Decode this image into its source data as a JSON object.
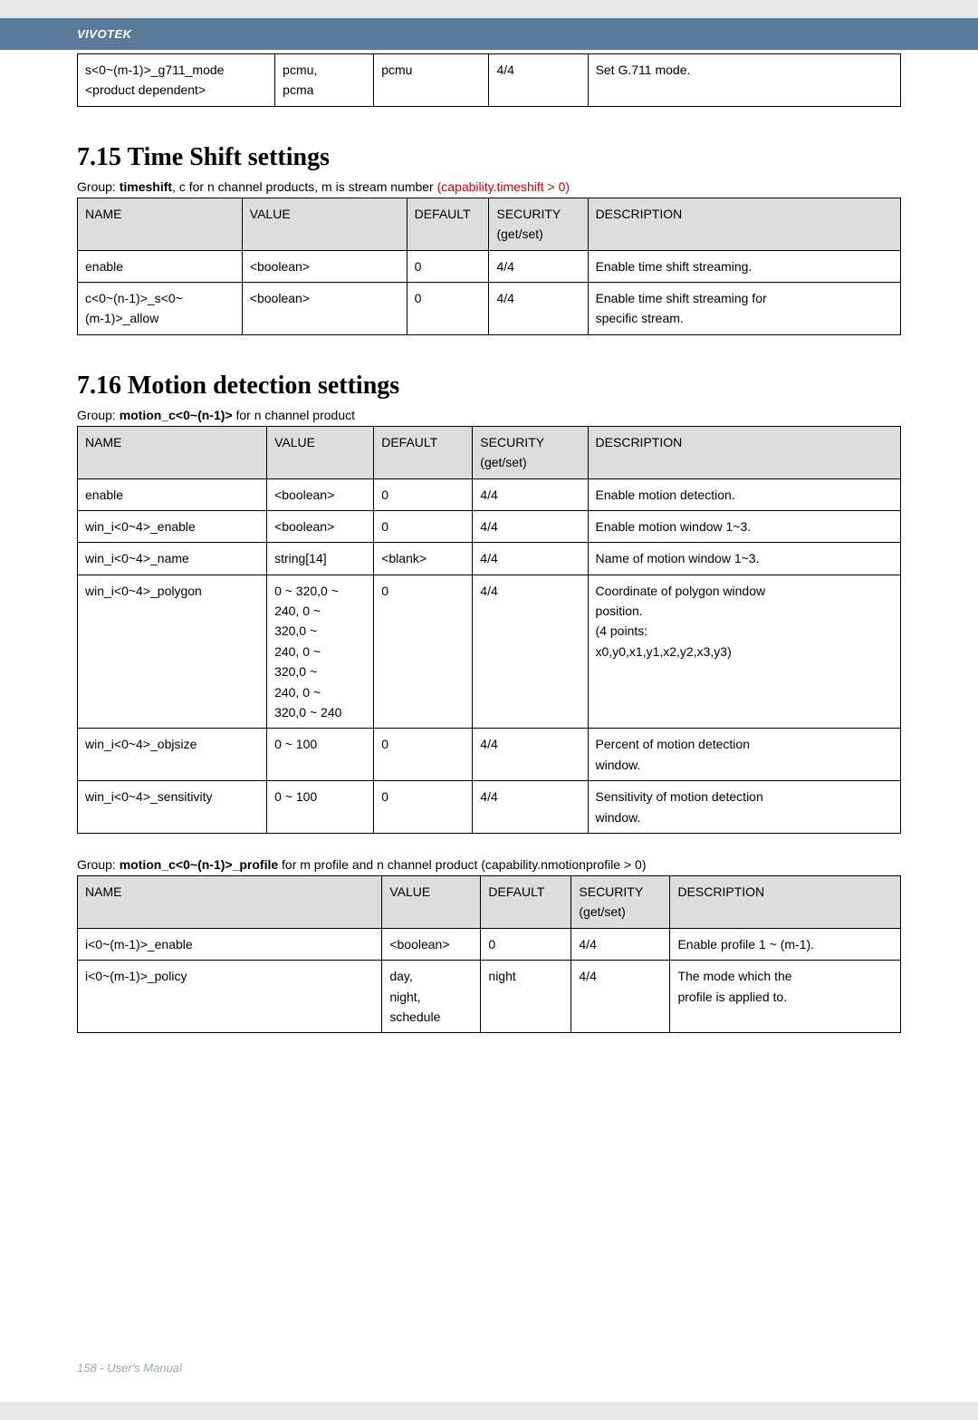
{
  "header": {
    "brand": "VIVOTEK"
  },
  "table1": {
    "r1c1": "s<0~(m-1)>_g711_mode",
    "r1c2": "pcmu,",
    "r1c3": "pcmu",
    "r1c4": "4/4",
    "r1c5": "Set G.711 mode.",
    "r2c1": "<product dependent>",
    "r2c2": "pcma"
  },
  "sec715": {
    "title": "7.15 Time Shift settings",
    "group_prefix": "Group: ",
    "group_bold": "timeshift",
    "group_rest": ", c for n channel products, m is stream number ",
    "group_red": "(capability.timeshift > 0)",
    "head": {
      "c1": "NAME",
      "c2": "VALUE",
      "c3": "DEFAULT",
      "c4": "SECURITY\n(get/set)",
      "c5": "DESCRIPTION"
    },
    "rows": [
      {
        "c1": "enable",
        "c2": "<boolean>",
        "c3": "0",
        "c4": "4/4",
        "c5": "Enable time shift streaming."
      },
      {
        "c1": "c<0~(n-1)>_s<0~(m-1)>_allow",
        "c2": "<boolean>",
        "c3": "0",
        "c4": "4/4",
        "c5a": "Enable time shift streaming for",
        "c5b": "specific stream."
      }
    ]
  },
  "sec716": {
    "title": "7.16 Motion detection settings",
    "group_prefix": "Group: ",
    "group_bold": "motion_c<0~(n-1)>",
    "group_rest": " for n channel product",
    "head": {
      "c1": "NAME",
      "c2": "VALUE",
      "c3": "DEFAULT",
      "c4": "SECURITY\n(get/set)",
      "c5": "DESCRIPTION"
    },
    "rows": [
      {
        "c1": "enable",
        "c2": "<boolean>",
        "c3": "0",
        "c4": "4/4",
        "c5": "Enable motion detection."
      },
      {
        "c1": "win_i<0~4>_enable",
        "c2": "<boolean>",
        "c3": "0",
        "c4": "4/4",
        "c5": "Enable motion window 1~3."
      },
      {
        "c1": "win_i<0~4>_name",
        "c2": "string[14]",
        "c3": "<blank>",
        "c4": "4/4",
        "c5": "Name of motion window 1~3."
      },
      {
        "c1": "win_i<0~4>_polygon",
        "c2": "0 ~ 320,0 ~ 240, 0 ~ 320,0 ~ 240, 0 ~ 320,0 ~ 240, 0 ~ 320,0 ~ 240",
        "c3": "0",
        "c4": "4/4",
        "c5": "Coordinate of polygon window position.\n(4 points: x0,y0,x1,y1,x2,y2,x3,y3)"
      },
      {
        "c1": "win_i<0~4>_objsize",
        "c2": "0 ~ 100",
        "c3": "0",
        "c4": "4/4",
        "c5": "Percent of motion detection window."
      },
      {
        "c1": "win_i<0~4>_sensitivity",
        "c2": "0 ~ 100",
        "c3": "0",
        "c4": "4/4",
        "c5": "Sensitivity of motion detection window."
      }
    ]
  },
  "profile": {
    "group_prefix": "Group: ",
    "group_bold": "motion_c<0~(n-1)>_profile",
    "group_rest": " for m profile and n channel product (capability.nmotionprofile > 0)",
    "head": {
      "c1": "NAME",
      "c2": "VALUE",
      "c3": "DEFAULT",
      "c4": "SECURITY\n(get/set)",
      "c5": "DESCRIPTION"
    },
    "rows": [
      {
        "c1": "i<0~(m-1)>_enable",
        "c2": "<boolean>",
        "c3": "0",
        "c4": "4/4",
        "c5": "Enable profile 1 ~ (m-1)."
      },
      {
        "c1": "i<0~(m-1)>_policy",
        "c2": "day,\nnight,\nschedule",
        "c3": "night",
        "c4": "4/4",
        "c5": "The mode which the profile is applied to."
      }
    ]
  },
  "footer": {
    "text": "158 - User's Manual"
  }
}
